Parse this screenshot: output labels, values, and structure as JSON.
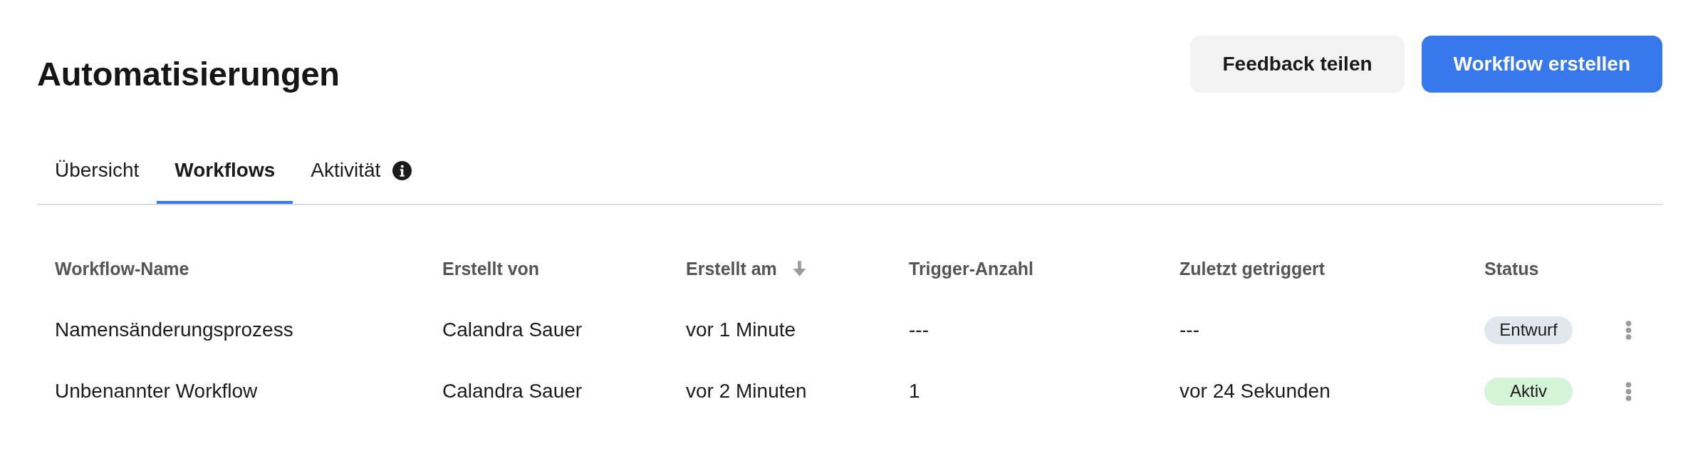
{
  "page": {
    "title": "Automatisierungen"
  },
  "actions": [
    {
      "label": "Feedback teilen",
      "kind": "secondary"
    },
    {
      "label": "Workflow erstellen",
      "kind": "primary"
    }
  ],
  "tabs": [
    {
      "label": "Übersicht",
      "selected": false,
      "info_icon": false
    },
    {
      "label": "Workflows",
      "selected": true,
      "info_icon": false
    },
    {
      "label": "Aktivität",
      "selected": false,
      "info_icon": true
    }
  ],
  "table": {
    "columns": [
      {
        "label": "Workflow-Name",
        "sorted": false
      },
      {
        "label": "Erstellt von",
        "sorted": false
      },
      {
        "label": "Erstellt am",
        "sorted": true,
        "descending": true
      },
      {
        "label": "Trigger-Anzahl",
        "sorted": false
      },
      {
        "label": "Zuletzt getriggert",
        "sorted": false
      },
      {
        "label": "Status",
        "sorted": false
      }
    ],
    "rows": [
      {
        "cells": [
          "Namensänderungsprozess",
          "Calandra Sauer",
          "vor 1 Minute",
          "---",
          "---"
        ],
        "status": {
          "label": "Entwurf",
          "color": "#e1e7ee"
        }
      },
      {
        "cells": [
          "Unbenannter Workflow",
          "Calandra Sauer",
          "vor 2 Minuten",
          "1",
          "vor 24 Sekunden"
        ],
        "status": {
          "label": "Aktiv",
          "color": "#d3f4d6"
        }
      }
    ]
  }
}
